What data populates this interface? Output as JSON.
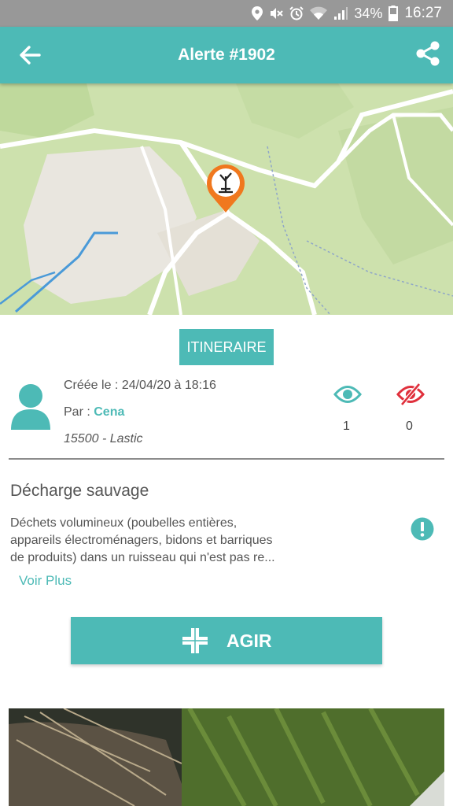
{
  "status_bar": {
    "battery": "34%",
    "time": "16:27"
  },
  "header": {
    "title": "Alerte #1902"
  },
  "actions": {
    "itinerary_label": "ITINERAIRE",
    "act_label": "AGIR"
  },
  "info": {
    "created": "Créée le : 24/04/20 à 18:16",
    "author_prefix": "Par : ",
    "author_name": "Cena",
    "location": "15500 - Lastic",
    "views_count": "1",
    "hidden_count": "0"
  },
  "alert": {
    "title": "Décharge sauvage",
    "description_lines": [
      "Déchets volumineux (poubelles entières,",
      "appareils électroménagers, bidons et barriques",
      "de produits) dans un ruisseau qui n'est pas re..."
    ],
    "voir_plus": "Voir Plus"
  },
  "colors": {
    "accent": "#4dbab6",
    "marker": "#f0781e",
    "danger": "#e0303c",
    "status_bar": "#989898"
  },
  "icons": [
    "location-icon",
    "mute-icon",
    "alarm-icon",
    "wifi-icon",
    "signal-icon",
    "battery-icon",
    "back-arrow-icon",
    "share-icon",
    "dump-marker-icon",
    "avatar-icon",
    "eye-icon",
    "eye-off-icon",
    "warning-icon",
    "plus-icon"
  ]
}
